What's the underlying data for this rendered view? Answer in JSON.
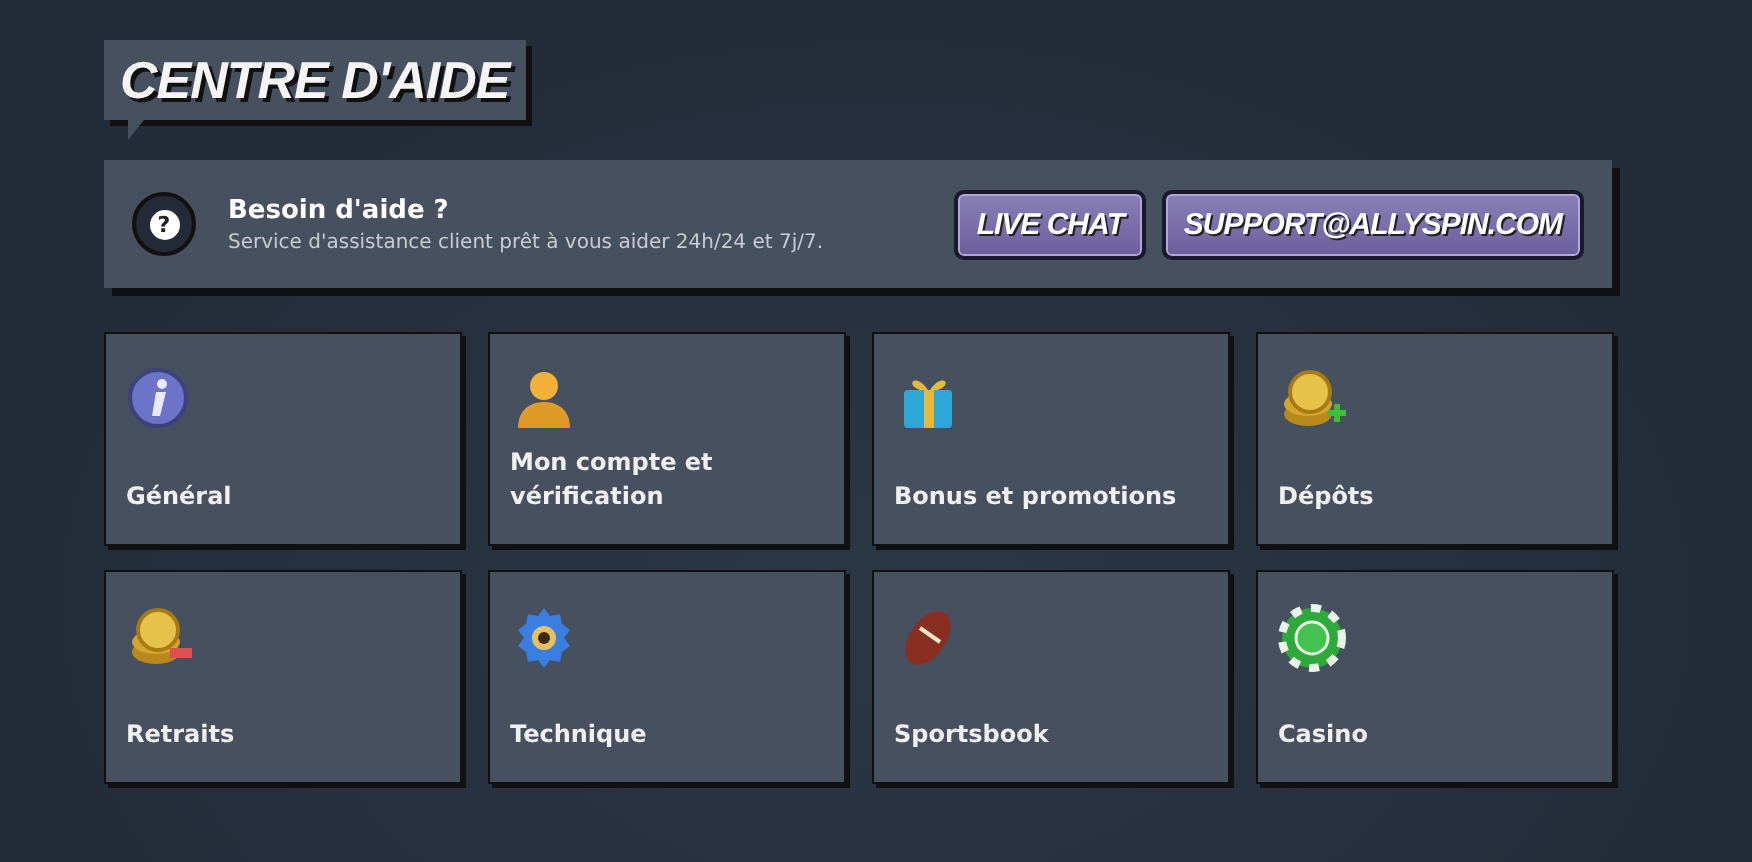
{
  "page_title": "CENTRE D'AIDE",
  "help_banner": {
    "icon_glyph": "?",
    "heading": "Besoin d'aide ?",
    "description": "Service d'assistance client prêt à vous aider 24h/24 et 7j/7.",
    "buttons": [
      "LIVE CHAT",
      "SUPPORT@ALLYSPIN.COM"
    ]
  },
  "categories": [
    {
      "label": "Général"
    },
    {
      "label": "Mon compte et vérification"
    },
    {
      "label": "Bonus et promotions"
    },
    {
      "label": "Dépôts"
    },
    {
      "label": "Retraits"
    },
    {
      "label": "Technique"
    },
    {
      "label": "Sportsbook"
    },
    {
      "label": "Casino"
    }
  ]
}
